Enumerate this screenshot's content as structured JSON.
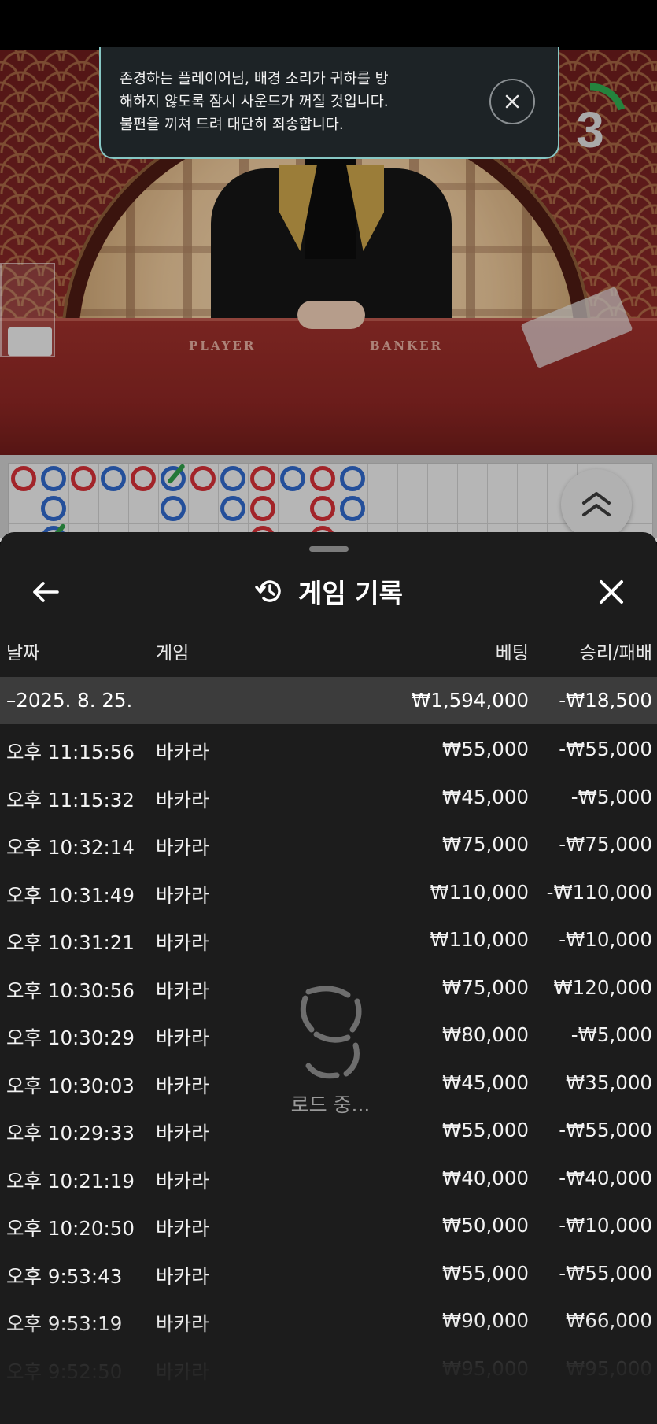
{
  "toast": {
    "message_line1": "존경하는 플레이어님, 배경 소리가 귀하를 방",
    "message_line2": "해하지 않도록 잠시 사운드가 꺼질 것입니다.",
    "message_line3": "불편을 끼쳐 드려 대단히 죄송합니다.",
    "close_icon": "close-icon"
  },
  "timer": {
    "value": "3",
    "progress": 0.2,
    "color": "#2fa84f"
  },
  "video": {
    "table_left_label": "PLAYER",
    "table_right_label": "BANKER"
  },
  "roadmap": {
    "colors": {
      "player": "#2f66c6",
      "banker": "#d02f35",
      "tie": "#2f9a47"
    },
    "expand_icon": "double-chevron-up-icon"
  },
  "history": {
    "title": "게임 기록",
    "title_icon": "history-clock-icon",
    "back_icon": "arrow-left-icon",
    "close_icon": "close-icon",
    "columns": {
      "date": "날짜",
      "game": "게임",
      "bet": "베팅",
      "result": "승리/패배"
    },
    "date_group": {
      "date": "–2025. 8. 25.",
      "bet_total": "₩1,594,000",
      "result_total": "-₩18,500"
    },
    "rows": [
      {
        "time": "오후 11:15:56",
        "game": "바카라",
        "bet": "₩55,000",
        "result": "-₩55,000"
      },
      {
        "time": "오후 11:15:32",
        "game": "바카라",
        "bet": "₩45,000",
        "result": "-₩5,000"
      },
      {
        "time": "오후 10:32:14",
        "game": "바카라",
        "bet": "₩75,000",
        "result": "-₩75,000"
      },
      {
        "time": "오후 10:31:49",
        "game": "바카라",
        "bet": "₩110,000",
        "result": "-₩110,000"
      },
      {
        "time": "오후 10:31:21",
        "game": "바카라",
        "bet": "₩110,000",
        "result": "-₩10,000"
      },
      {
        "time": "오후 10:30:56",
        "game": "바카라",
        "bet": "₩75,000",
        "result": "₩120,000"
      },
      {
        "time": "오후 10:30:29",
        "game": "바카라",
        "bet": "₩80,000",
        "result": "-₩5,000"
      },
      {
        "time": "오후 10:30:03",
        "game": "바카라",
        "bet": "₩45,000",
        "result": "₩35,000"
      },
      {
        "time": "오후 10:29:33",
        "game": "바카라",
        "bet": "₩55,000",
        "result": "-₩55,000"
      },
      {
        "time": "오후 10:21:19",
        "game": "바카라",
        "bet": "₩40,000",
        "result": "-₩40,000"
      },
      {
        "time": "오후 10:20:50",
        "game": "바카라",
        "bet": "₩50,000",
        "result": "-₩10,000"
      },
      {
        "time": "오후 9:53:43",
        "game": "바카라",
        "bet": "₩55,000",
        "result": "-₩55,000"
      },
      {
        "time": "오후 9:53:19",
        "game": "바카라",
        "bet": "₩90,000",
        "result": "₩66,000"
      },
      {
        "time": "오후 9:52:50",
        "game": "바카라",
        "bet": "₩95,000",
        "result": "₩95,000"
      }
    ],
    "loading_text": "로드 중...",
    "loading_icon": "spinner-icon"
  }
}
